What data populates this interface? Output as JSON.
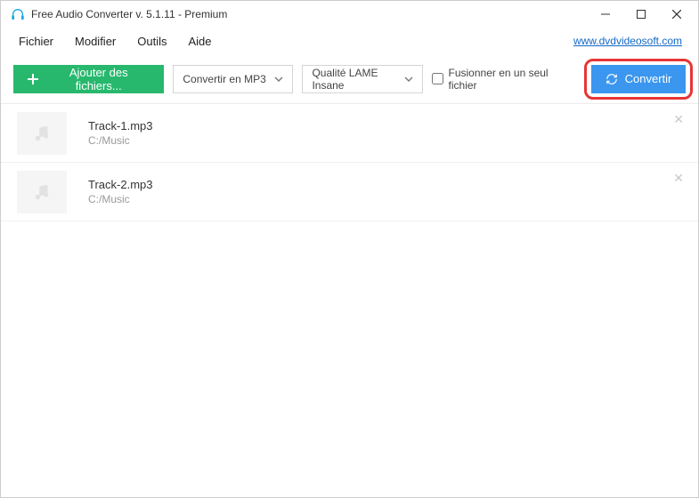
{
  "window": {
    "title": "Free Audio Converter v. 5.1.11 - Premium"
  },
  "menubar": {
    "items": [
      "Fichier",
      "Modifier",
      "Outils",
      "Aide"
    ],
    "link_text": "www.dvdvideosoft.com"
  },
  "toolbar": {
    "add_label": "Ajouter des fichiers...",
    "format_selected": "Convertir en MP3",
    "quality_selected": "Qualité LAME Insane",
    "merge_label": "Fusionner en un seul fichier",
    "convert_label": "Convertir"
  },
  "tracks": [
    {
      "name": "Track-1.mp3",
      "path": "C:/Music"
    },
    {
      "name": "Track-2.mp3",
      "path": "C:/Music"
    }
  ]
}
